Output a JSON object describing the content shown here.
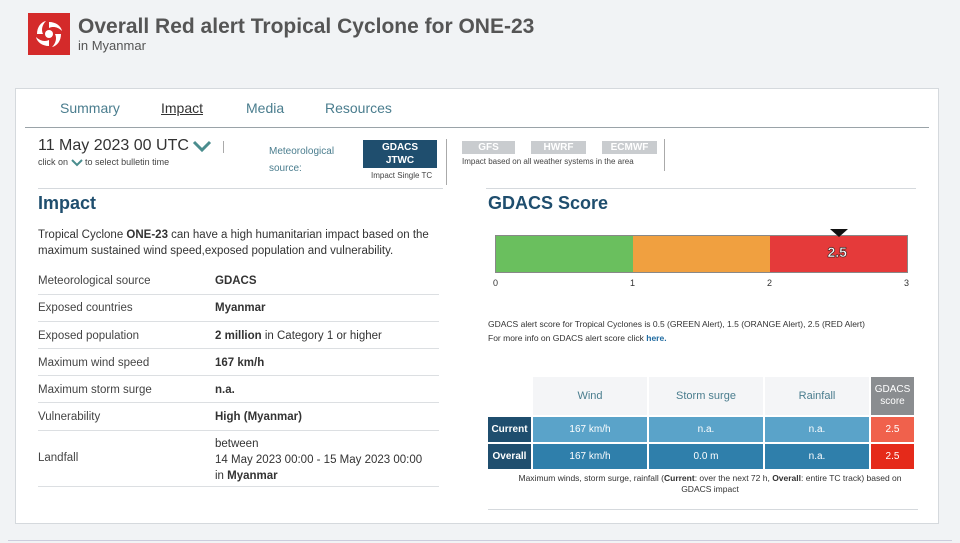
{
  "header": {
    "title": "Overall Red alert Tropical Cyclone for ONE-23",
    "subtitle": "in Myanmar"
  },
  "tabs": [
    {
      "label": "Summary",
      "active": false
    },
    {
      "label": "Impact",
      "active": true
    },
    {
      "label": "Media",
      "active": false
    },
    {
      "label": "Resources",
      "active": false
    }
  ],
  "bulletin": {
    "date": "11 May 2023 00 UTC",
    "hint_before": "click on",
    "hint_after": "to select bulletin time"
  },
  "met_source": {
    "label_line1": "Meteorological",
    "label_line2": "source:",
    "active_line1": "GDACS",
    "active_line2": "JTWC",
    "active_note": "Impact Single TC",
    "others": [
      "GFS",
      "HWRF",
      "ECMWF"
    ],
    "others_note": "Impact based on all weather systems in the area"
  },
  "impact": {
    "heading": "Impact",
    "desc_before": "Tropical Cyclone ",
    "desc_name": "ONE-23",
    "desc_after": " can have a high humanitarian impact based on the maximum sustained wind speed,exposed population and vulnerability.",
    "rows": [
      {
        "label": "Meteorological source",
        "value": "GDACS"
      },
      {
        "label": "Exposed countries",
        "value": "Myanmar"
      },
      {
        "label": "Exposed population",
        "value_bold": "2 million",
        "value_rest": " in Category 1 or higher"
      },
      {
        "label": "Maximum wind speed",
        "value": "167 km/h"
      },
      {
        "label": "Maximum storm surge",
        "value": "n.a."
      },
      {
        "label": "Vulnerability",
        "value": "High (Myanmar)"
      }
    ],
    "landfall": {
      "label": "Landfall",
      "line1": "between",
      "line2": "14 May 2023 00:00 - 15 May 2023 00:00",
      "line3_prefix": "in ",
      "line3_country": "Myanmar"
    }
  },
  "score": {
    "heading": "GDACS Score",
    "value": 2.5,
    "value_label": "2.5",
    "max": 3,
    "ticks": [
      "0",
      "1",
      "2",
      "3"
    ],
    "colors": {
      "green": "#6abf5e",
      "orange": "#f0a040",
      "red": "#e53a3a"
    },
    "note_line1": "GDACS alert score for Tropical Cyclones is 0.5 (GREEN Alert), 1.5 (ORANGE Alert), 2.5 (RED Alert)",
    "note_line2": "For more info on GDACS alert score click ",
    "note_link": "here."
  },
  "score_table": {
    "headers": [
      "Wind",
      "Storm surge",
      "Rainfall"
    ],
    "score_header_line1": "GDACS",
    "score_header_line2": "score",
    "rows": [
      {
        "label": "Current",
        "wind": "167 km/h",
        "surge": "n.a.",
        "rain": "n.a.",
        "score": "2.5"
      },
      {
        "label": "Overall",
        "wind": "167 km/h",
        "surge": "0.0 m",
        "rain": "n.a.",
        "score": "2.5"
      }
    ],
    "note_line1_a": "Maximum winds, storm surge, rainfall (",
    "note_current": "Current",
    "note_line1_b": ": over the next 72 h, ",
    "note_overall": "Overall",
    "note_line1_c": ": entire TC track) based on",
    "note_line2": "GDACS impact"
  }
}
